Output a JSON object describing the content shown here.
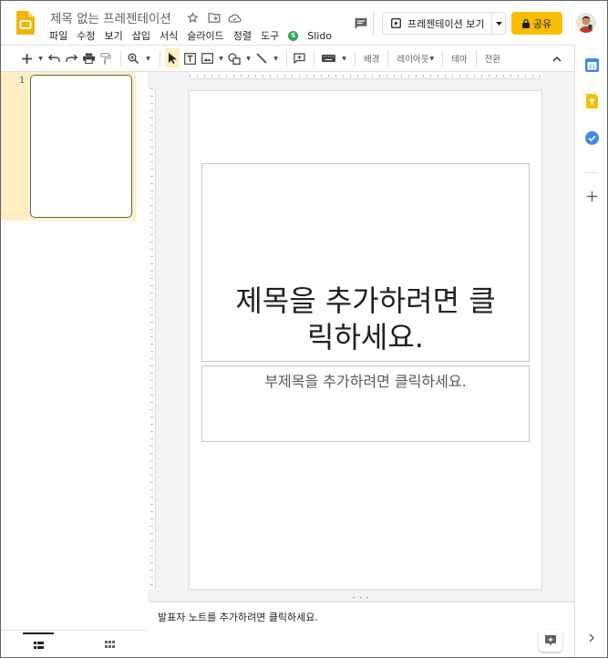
{
  "header": {
    "doc_title": "제목 없는 프레젠테이션",
    "menu": [
      "파일",
      "수정",
      "보기",
      "삽입",
      "서식",
      "슬라이드",
      "정렬",
      "도구"
    ],
    "slido_label": "Slido",
    "present_label": "프레젠테이션 보기",
    "share_label": "공유",
    "colors": {
      "share_button": "#fbbc04",
      "slides_brand": "#f4b400",
      "slido_green": "#34a853"
    }
  },
  "toolbar": {
    "background_label": "배경",
    "layout_label": "레이아웃",
    "theme_label": "테마",
    "transition_label": "전환"
  },
  "filmstrip": {
    "slides": [
      {
        "number": "1"
      }
    ]
  },
  "slide": {
    "title_placeholder": "제목을 추가하려면 클릭하세요.",
    "subtitle_placeholder": "부제목을 추가하려면 클릭하세요."
  },
  "notes": {
    "placeholder": "발표자 노트를 추가하려면 클릭하세요."
  }
}
